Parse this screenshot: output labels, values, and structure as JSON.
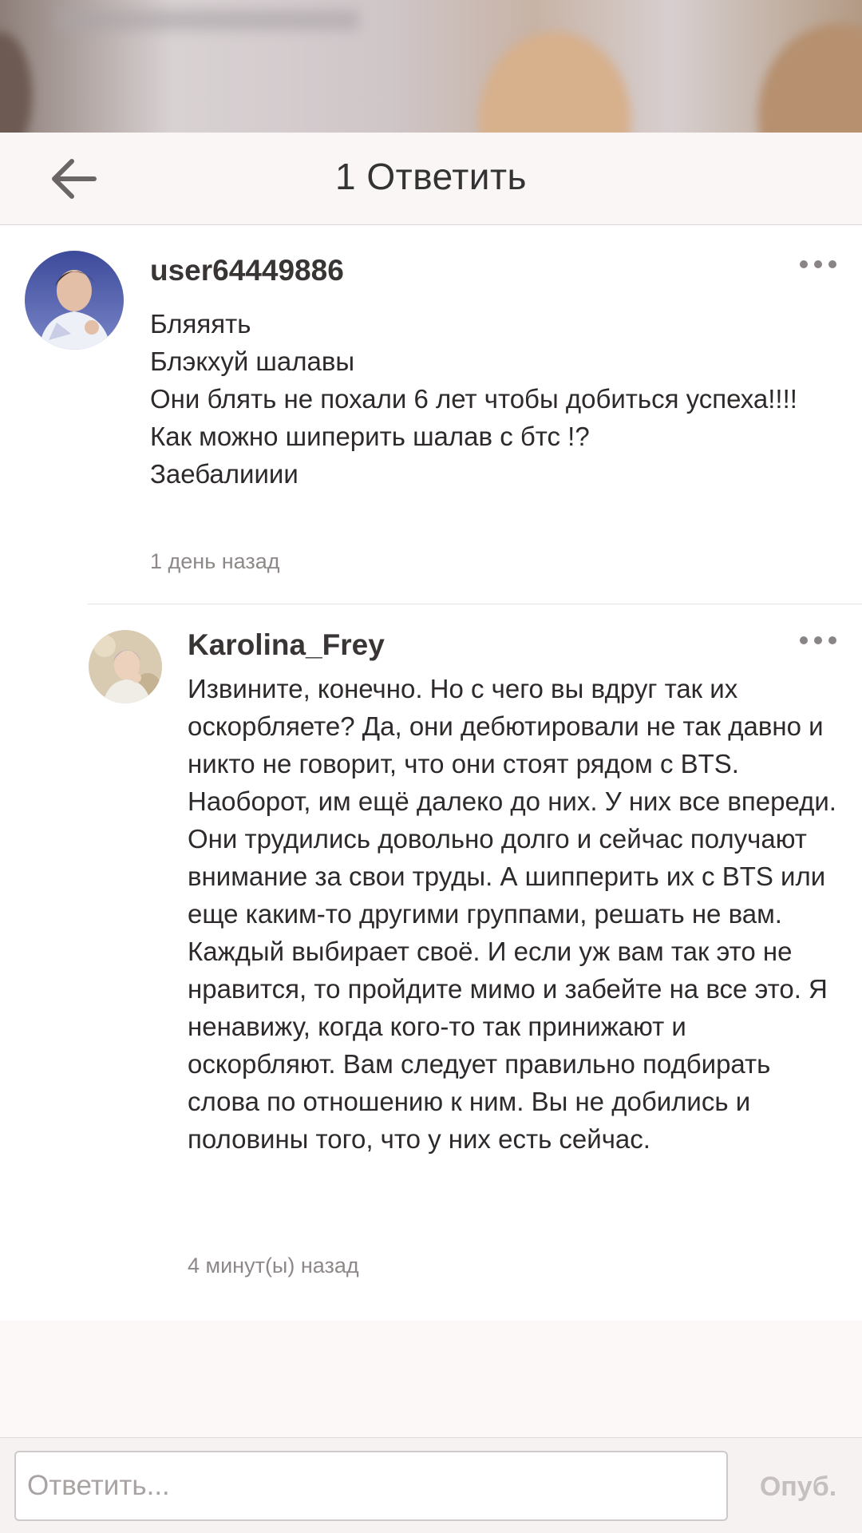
{
  "header": {
    "title": "1 Ответить"
  },
  "comments": [
    {
      "username": "user64449886",
      "text": "Бляяять\nБлэкхуй шалавы\nОни блять не похали 6 лет чтобы добиться успеха!!!!\nКак можно шиперить шалав с бтс !?\nЗаебалииии",
      "timestamp": "1 день назад"
    },
    {
      "username": "Karolina_Frey",
      "text": "Извините, конечно.  Но с чего вы вдруг так их оскорбляете? Да, они дебютировали не так давно и никто не говорит, что они стоят рядом с BTS. Наоборот, им ещё далеко до них. У них все впереди. Они трудились довольно долго и сейчас получают внимание за свои труды. А шипперить  их с BTS или еще каким-то другими группами, решать не вам. Каждый выбирает своё. И если уж вам так это не нравится, то пройдите мимо и забейте на все это. Я ненавижу, когда кого-то так принижают и оскорбляют.  Вам следует правильно подбирать слова по отношению к ним. Вы не добились и половины того, что у них есть сейчас.",
      "timestamp": "4 минут(ы) назад"
    }
  ],
  "composer": {
    "placeholder": "Ответить...",
    "publish_label": "Опуб."
  },
  "colors": {
    "header_bg": "#f9f6f5",
    "text": "#2f2b2b",
    "muted": "#8e8888",
    "publish_disabled": "#c5bfbf"
  }
}
